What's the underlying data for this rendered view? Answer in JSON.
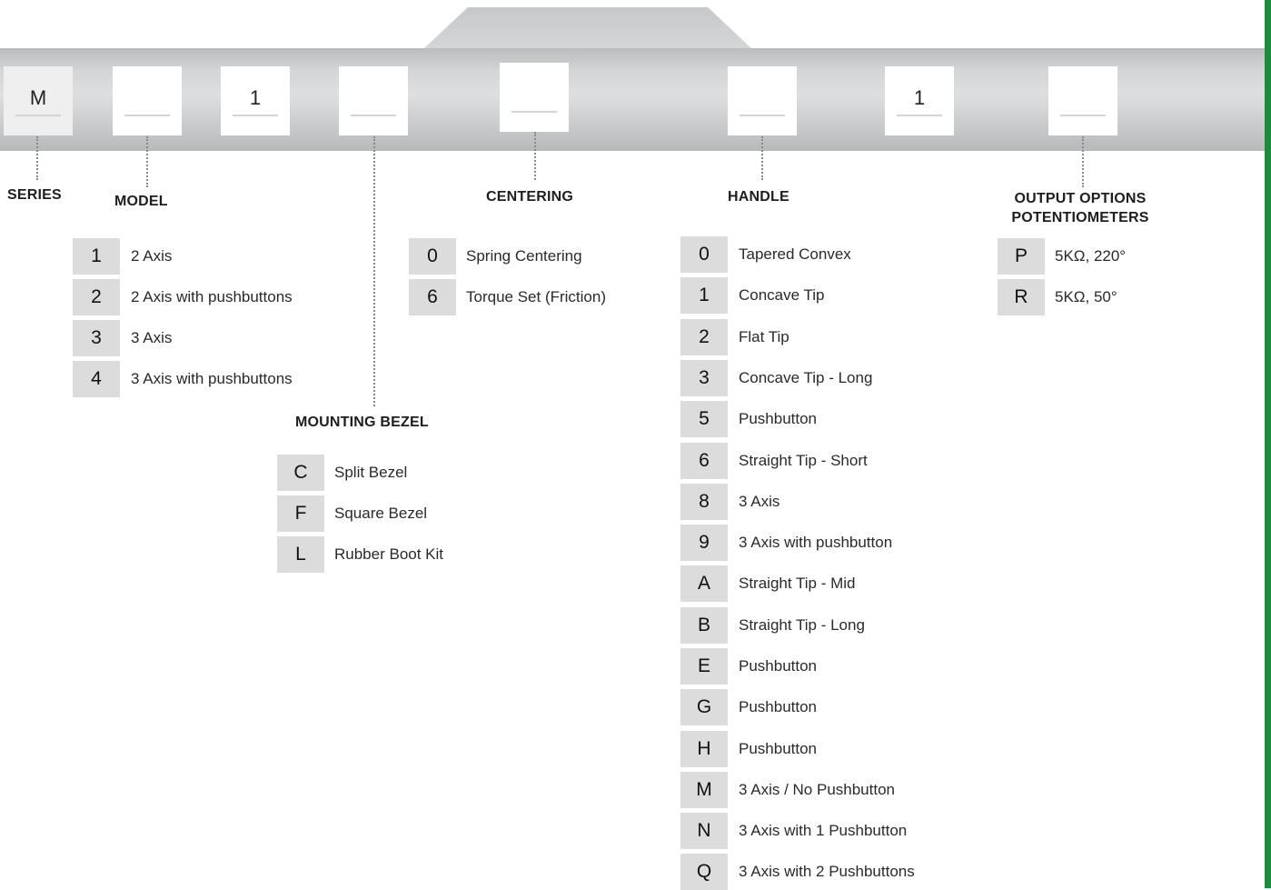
{
  "slots": [
    "M",
    "",
    "1",
    "",
    "",
    "",
    "1",
    ""
  ],
  "headers": {
    "series": "SERIES",
    "model": "MODEL",
    "mounting_bezel": "MOUNTING BEZEL",
    "centering": "CENTERING",
    "handle": "HANDLE",
    "output_line1": "OUTPUT OPTIONS",
    "output_line2": "POTENTIOMETERS"
  },
  "model": [
    {
      "code": "1",
      "label": "2 Axis"
    },
    {
      "code": "2",
      "label": "2 Axis with pushbuttons"
    },
    {
      "code": "3",
      "label": "3 Axis"
    },
    {
      "code": "4",
      "label": "3 Axis with pushbuttons"
    }
  ],
  "centering": [
    {
      "code": "0",
      "label": "Spring Centering"
    },
    {
      "code": "6",
      "label": "Torque Set (Friction)"
    }
  ],
  "mounting_bezel": [
    {
      "code": "C",
      "label": "Split Bezel"
    },
    {
      "code": "F",
      "label": "Square Bezel"
    },
    {
      "code": "L",
      "label": "Rubber Boot Kit"
    }
  ],
  "handle": [
    {
      "code": "0",
      "label": "Tapered Convex"
    },
    {
      "code": "1",
      "label": "Concave Tip"
    },
    {
      "code": "2",
      "label": "Flat Tip"
    },
    {
      "code": "3",
      "label": "Concave Tip - Long"
    },
    {
      "code": "5",
      "label": "Pushbutton"
    },
    {
      "code": "6",
      "label": "Straight Tip - Short"
    },
    {
      "code": "8",
      "label": "3 Axis"
    },
    {
      "code": "9",
      "label": "3 Axis with pushbutton"
    },
    {
      "code": "A",
      "label": "Straight Tip - Mid"
    },
    {
      "code": "B",
      "label": "Straight Tip - Long"
    },
    {
      "code": "E",
      "label": "Pushbutton"
    },
    {
      "code": "G",
      "label": "Pushbutton"
    },
    {
      "code": "H",
      "label": "Pushbutton"
    },
    {
      "code": "M",
      "label": "3 Axis / No Pushbutton"
    },
    {
      "code": "N",
      "label": "3 Axis with 1 Pushbutton"
    },
    {
      "code": "Q",
      "label": "3 Axis with 2 Pushbuttons"
    }
  ],
  "output_options": [
    {
      "code": "P",
      "label": "5KΩ, 220°"
    },
    {
      "code": "R",
      "label": "5KΩ, 50°"
    }
  ],
  "colors": {
    "band": "#cfd1d2",
    "code_cell": "#dcdcdc",
    "edge": "#1f8a3c",
    "connector": "#8a8a8a"
  }
}
